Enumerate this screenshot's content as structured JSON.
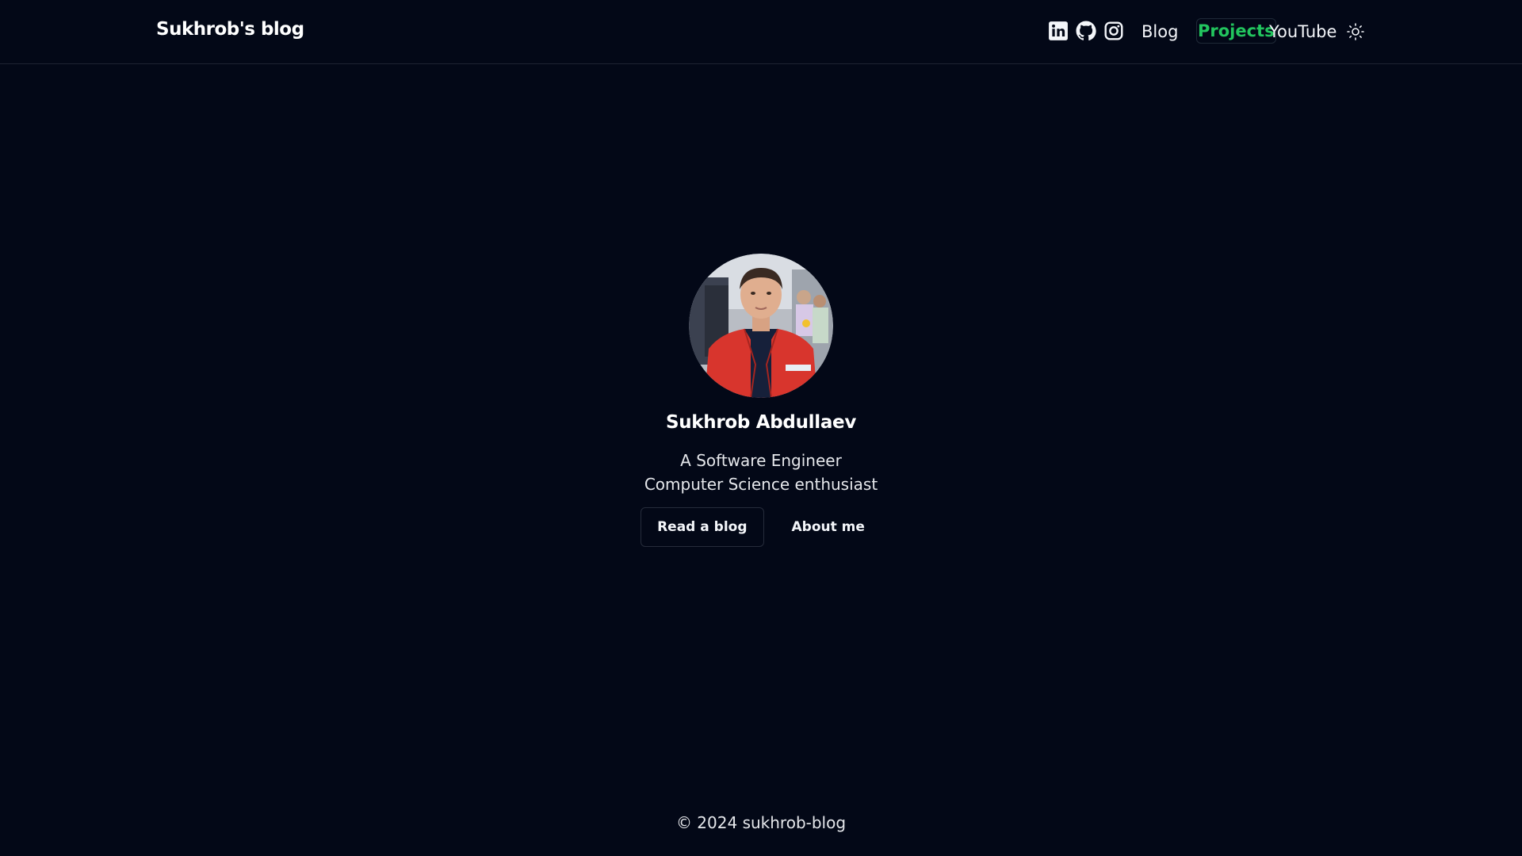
{
  "header": {
    "brand": "Sukhrob's blog",
    "social": [
      {
        "icon": "linkedin-icon"
      },
      {
        "icon": "github-icon"
      },
      {
        "icon": "instagram-icon"
      }
    ],
    "nav": {
      "blog": "Blog",
      "projects": "Projects",
      "youtube": "YouTube"
    },
    "theme_icon": "sun-icon"
  },
  "hero": {
    "name": "Sukhrob Abdullaev",
    "tagline_line1": "A Software Engineer",
    "tagline_line2": "Computer Science enthusiast",
    "primary_button": "Read a blog",
    "secondary_button": "About me"
  },
  "footer": {
    "copyright": "© 2024 sukhrob-blog"
  },
  "colors": {
    "background": "#030817",
    "accent": "#22c55e",
    "text": "#f4f6fa",
    "border": "#1e2433"
  }
}
